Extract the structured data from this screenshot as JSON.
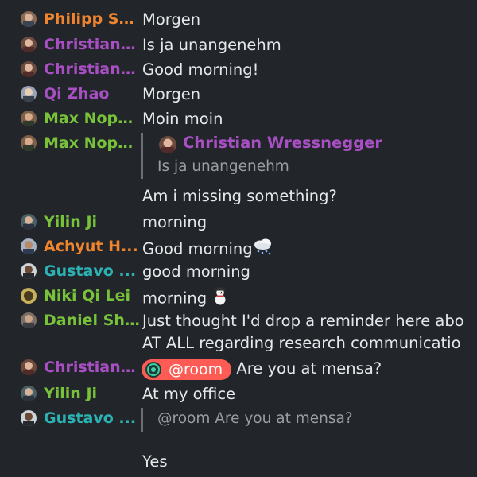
{
  "colors": {
    "background": "#22262b",
    "orange": "#f0852d",
    "purple": "#a94fc4",
    "green": "#78c23a",
    "teal": "#2bb3b4",
    "mention_pill": "#ff5b55"
  },
  "messages": [
    {
      "sender": "Philipp Sc...",
      "sender_color": "orange",
      "text": "Morgen"
    },
    {
      "sender": "Christian ...",
      "sender_color": "purple",
      "text": "Is ja unangenehm"
    },
    {
      "sender": "Christian ...",
      "sender_color": "purple",
      "text": "Good morning!"
    },
    {
      "sender": "Qi Zhao",
      "sender_color": "purple",
      "text": "Morgen"
    },
    {
      "sender": "Max Nopp...",
      "sender_color": "green",
      "text": "Moin moin"
    },
    {
      "sender": "Max Nopp...",
      "sender_color": "green",
      "reply_to": {
        "sender": "Christian Wressnegger",
        "text": "Is ja unangenehm"
      },
      "text": "Am i missing something?"
    },
    {
      "sender": "Yilin Ji",
      "sender_color": "green",
      "text": "morning"
    },
    {
      "sender": "Achyut H...",
      "sender_color": "orange",
      "text": "Good morning",
      "emoji": "snow-cloud-icon"
    },
    {
      "sender": "Gustavo ...",
      "sender_color": "teal",
      "text": "good morning"
    },
    {
      "sender": "Niki Qi Lei",
      "sender_color": "green",
      "text": "morning",
      "emoji": "snowman-icon"
    },
    {
      "sender": "Daniel Shea",
      "sender_color": "green",
      "text": "Just thought I'd drop a reminder here abo",
      "text_line2": "AT ALL regarding research communicatio"
    },
    {
      "sender": "Christian ...",
      "sender_color": "purple",
      "mention": "@room",
      "text": "Are you at mensa?"
    },
    {
      "sender": "Yilin Ji",
      "sender_color": "green",
      "text": "At my office"
    },
    {
      "sender": "Gustavo ...",
      "sender_color": "teal",
      "reply_to": {
        "text": "@room Are you at mensa?"
      },
      "text": "Yes"
    }
  ]
}
